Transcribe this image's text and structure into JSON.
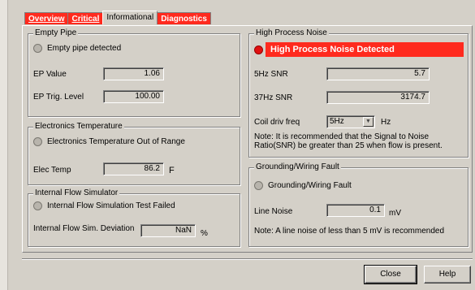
{
  "tabs": [
    {
      "label": "Overview"
    },
    {
      "label": "Critical"
    },
    {
      "label": "Informational"
    },
    {
      "label": "Diagnostics"
    }
  ],
  "empty_pipe": {
    "title": "Empty Pipe",
    "indicator": "Empty pipe detected",
    "ep_value_label": "EP Value",
    "ep_value": "1.06",
    "ep_trig_label": "EP Trig. Level",
    "ep_trig_value": "100.00"
  },
  "electronics_temp": {
    "title": "Electronics Temperature",
    "indicator": "Electronics Temperature Out of Range",
    "elec_temp_label": "Elec Temp",
    "elec_temp_value": "86.2",
    "elec_temp_unit": "F"
  },
  "flow_sim": {
    "title": "Internal Flow Simulator",
    "indicator": "Internal Flow Simulation Test Failed",
    "deviation_label": "Internal Flow Sim. Deviation",
    "deviation_value": "NaN",
    "deviation_unit": "%"
  },
  "process_noise": {
    "title": "High Process Noise",
    "alert": "High Process Noise Detected",
    "snr5_label": "5Hz SNR",
    "snr5_value": "5.7",
    "snr37_label": "37Hz SNR",
    "snr37_value": "3174.7",
    "coil_label": "Coil driv freq",
    "coil_value": "5Hz",
    "coil_unit": "Hz",
    "note": "Note: It is recommended that the Signal to Noise Ratio(SNR) be greater than 25 when flow is present."
  },
  "grounding": {
    "title": "Grounding/Wiring Fault",
    "indicator": "Grounding/Wiring Fault",
    "line_noise_label": "Line Noise",
    "line_noise_value": "0.1",
    "line_noise_unit": "mV",
    "note": "Note: A line noise of less than 5 mV is recommended"
  },
  "buttons": {
    "close": "Close",
    "help": "Help"
  },
  "colors": {
    "alert_red": "#ff2a1e",
    "dialog_gray": "#d4d0c8"
  }
}
